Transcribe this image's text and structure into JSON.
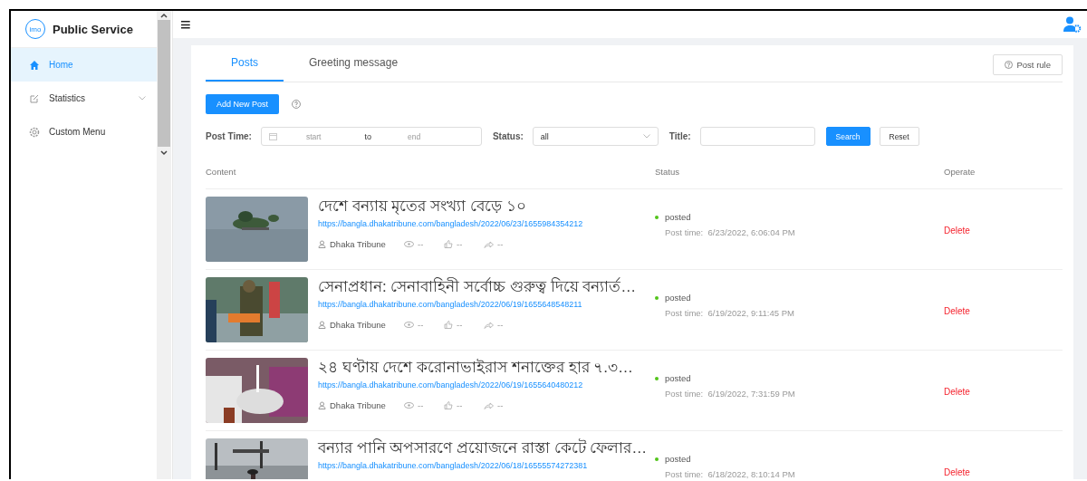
{
  "sidebar": {
    "logo_text": "imo",
    "title": "Public Service",
    "items": [
      {
        "label": "Home",
        "kind": "home",
        "selected": true,
        "expandable": false
      },
      {
        "label": "Statistics",
        "kind": "edit",
        "selected": false,
        "expandable": true
      },
      {
        "label": "Custom Menu",
        "kind": "gear",
        "selected": false,
        "expandable": false
      }
    ]
  },
  "header": {
    "menu_icon": "≡"
  },
  "tabs": [
    {
      "label": "Posts",
      "selected": true
    },
    {
      "label": "Greeting message",
      "selected": false
    }
  ],
  "post_rule_button": "Post rule",
  "add_button": "Add New Post",
  "filters": {
    "post_time_label": "Post Time:",
    "start_placeholder": "start",
    "to_label": "to",
    "end_placeholder": "end",
    "status_label": "Status:",
    "status_value": "all",
    "title_label": "Title:",
    "search_button": "Search",
    "reset_button": "Reset"
  },
  "columns": [
    "Content",
    "Status",
    "Operate"
  ],
  "posts": [
    {
      "title": "দেশে বন্যায় মৃতের সংখ্যা বেড়ে ১০",
      "url": "https://bangla.dhakatribune.com/bangladesh/2022/06/23/1655984354212",
      "author": "Dhaka Tribune",
      "views": "--",
      "likes": "--",
      "shares": "--",
      "status": "posted",
      "time_label": "Post time:",
      "time": "6/23/2022, 6:06:04 PM",
      "action": "Delete"
    },
    {
      "title": "সেনাপ্রধান: সেনাবাহিনী সর্বোচ্চ গুরুত্ব দিয়ে বন্যার্ত…",
      "url": "https://bangla.dhakatribune.com/bangladesh/2022/06/19/1655648548211",
      "author": "Dhaka Tribune",
      "views": "--",
      "likes": "--",
      "shares": "--",
      "status": "posted",
      "time_label": "Post time:",
      "time": "6/19/2022, 9:11:45 PM",
      "action": "Delete"
    },
    {
      "title": "২৪ ঘণ্টায় দেশে করোনাভাইরাস শনাক্তের হার ৭.৩…",
      "url": "https://bangla.dhakatribune.com/bangladesh/2022/06/19/1655640480212",
      "author": "Dhaka Tribune",
      "views": "--",
      "likes": "--",
      "shares": "--",
      "status": "posted",
      "time_label": "Post time:",
      "time": "6/19/2022, 7:31:59 PM",
      "action": "Delete"
    },
    {
      "title": "বন্যার পানি অপসারণে প্রয়োজনে রাস্তা কেটে ফেলার…",
      "url": "https://bangla.dhakatribune.com/bangladesh/2022/06/18/16555574272381",
      "status": "posted",
      "time_label": "Post time:",
      "time": "6/18/2022, 8:10:14 PM",
      "action": "Delete"
    }
  ]
}
